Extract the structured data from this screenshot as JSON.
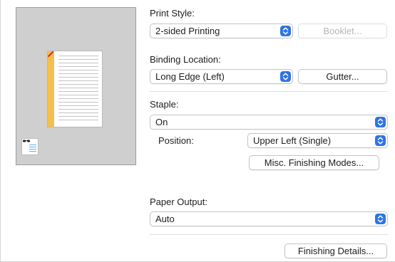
{
  "preview": {
    "alt_icon": "document-preview-icon",
    "thumb_icon": "page-layout-thumbnail-icon"
  },
  "print_style": {
    "label": "Print Style:",
    "value": "2-sided Printing",
    "booklet_button": "Booklet..."
  },
  "binding": {
    "label": "Binding Location:",
    "value": "Long Edge (Left)",
    "gutter_button": "Gutter..."
  },
  "staple": {
    "label": "Staple:",
    "value": "On",
    "position_label": "Position:",
    "position_value": "Upper Left (Single)",
    "misc_button": "Misc. Finishing Modes..."
  },
  "paper_output": {
    "label": "Paper Output:",
    "value": "Auto"
  },
  "finishing_details_button": "Finishing Details...",
  "colors": {
    "accent": "#2f73e6",
    "binding_strip": "#f5c04a",
    "staple": "#e02020",
    "preview_bg": "#cfcfcf"
  }
}
